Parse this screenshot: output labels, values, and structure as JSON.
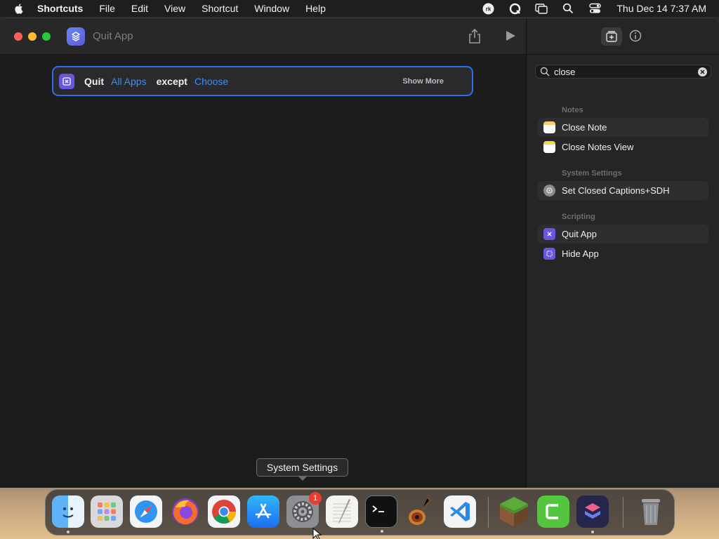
{
  "menubar": {
    "app_name": "Shortcuts",
    "menus": [
      "File",
      "Edit",
      "View",
      "Shortcut",
      "Window",
      "Help"
    ],
    "clock": "Thu Dec 14  7:37 AM",
    "status_icons": [
      "rk-icon",
      "quicksilver-icon",
      "display-icon",
      "search-icon",
      "control-center-icon"
    ]
  },
  "window": {
    "title": "Quit App"
  },
  "action": {
    "verb": "Quit",
    "target": "All Apps",
    "connector": "except",
    "choose": "Choose",
    "show_more": "Show More"
  },
  "sidebar": {
    "search_value": "close",
    "groups": [
      {
        "header": "Notes",
        "items": [
          "Close Note",
          "Close Notes View"
        ]
      },
      {
        "header": "System Settings",
        "items": [
          "Set Closed Captions+SDH"
        ]
      },
      {
        "header": "Scripting",
        "items": [
          "Quit App",
          "Hide App"
        ]
      }
    ]
  },
  "tooltip": {
    "text": "System Settings"
  },
  "dock": {
    "apps": [
      "Finder",
      "Launchpad",
      "Safari",
      "Firefox",
      "Chrome",
      "App Store",
      "System Settings",
      "TextEdit",
      "Terminal",
      "GarageBand",
      "VS Code",
      "Minecraft",
      "Camtasia",
      "Shortcuts",
      "Trash"
    ],
    "system_settings_badge": "1"
  },
  "colors": {
    "accent": "#2f6fea",
    "variable_blue": "#3d8df5",
    "script_purple": "#6858e0",
    "close": "#ff5f57",
    "minimize": "#febc2e",
    "maximize": "#28c840"
  }
}
